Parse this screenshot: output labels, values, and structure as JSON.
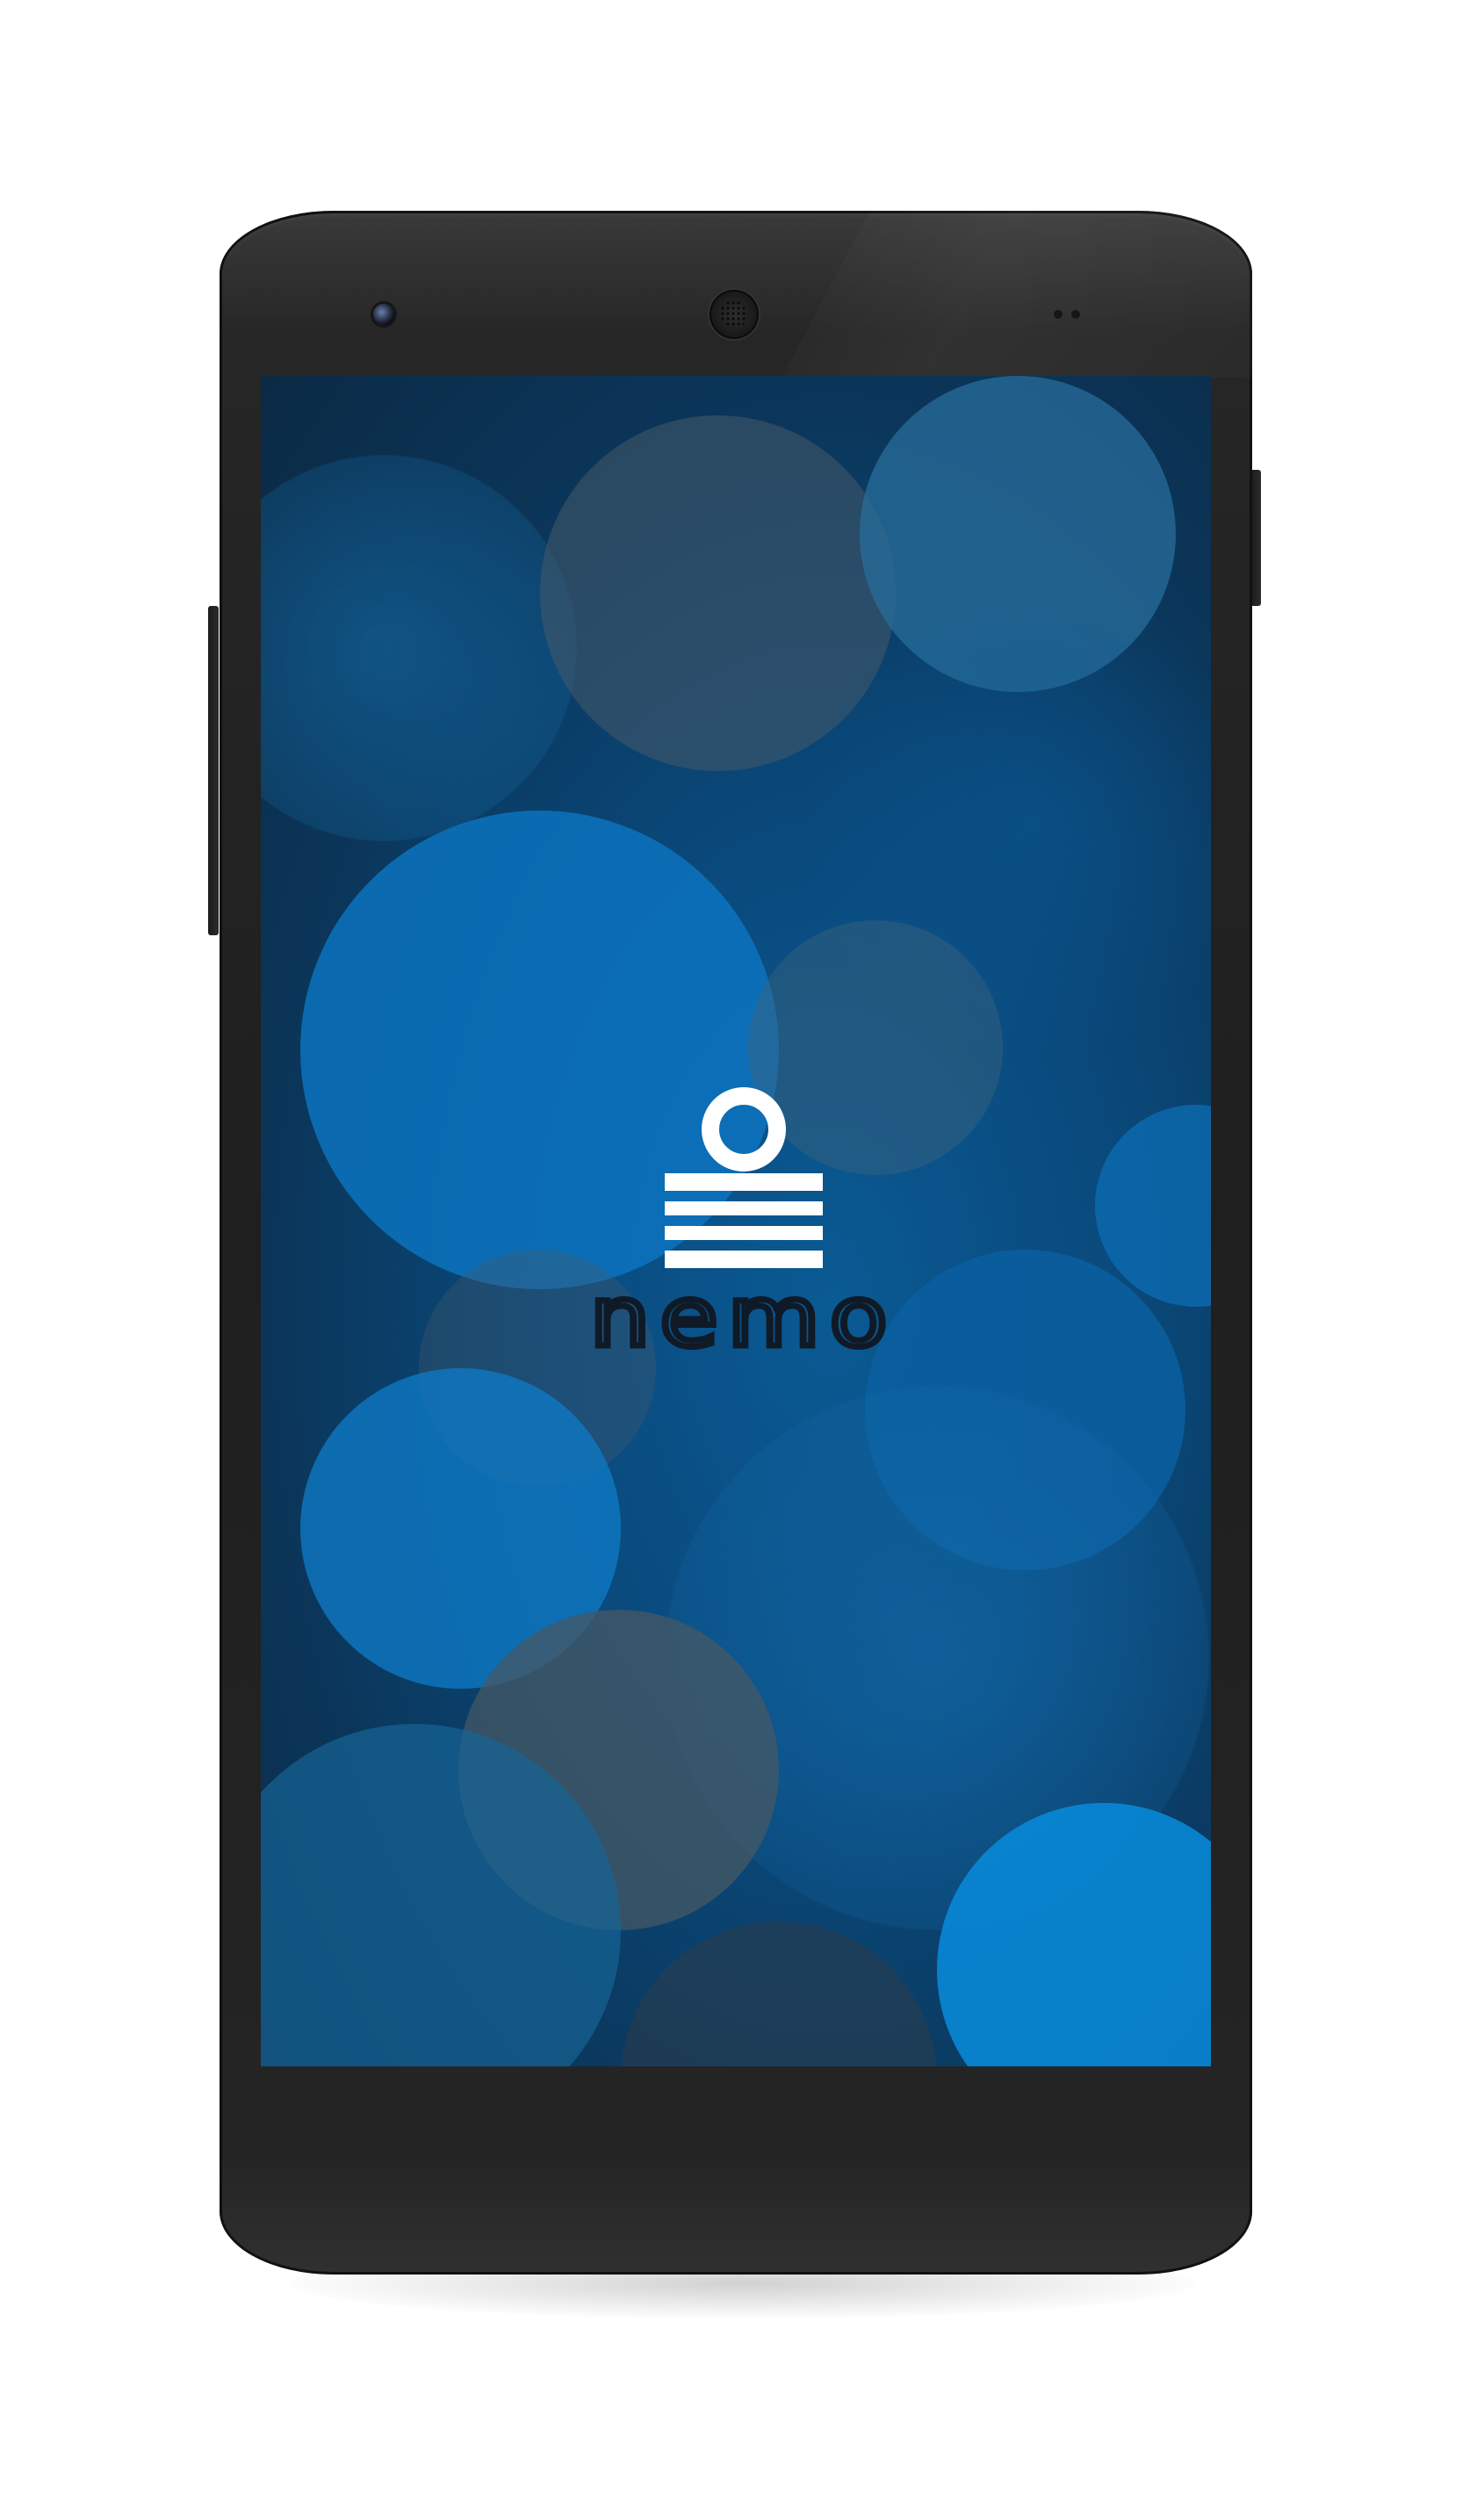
{
  "device": {
    "model": "phone",
    "frame_color": "#222222"
  },
  "screen": {
    "wallpaper": "blue-bokeh",
    "background_color": "#0a4a7d",
    "bokeh_colors": [
      "#0b6fb8",
      "#2a6f9a",
      "#3a5060",
      "#1e6ea3"
    ]
  },
  "app": {
    "logo_icon": "nemo-weight-icon",
    "logo_color": "#ffffff",
    "wordmark": "nemo",
    "wordmark_color": "#0f1a26"
  }
}
